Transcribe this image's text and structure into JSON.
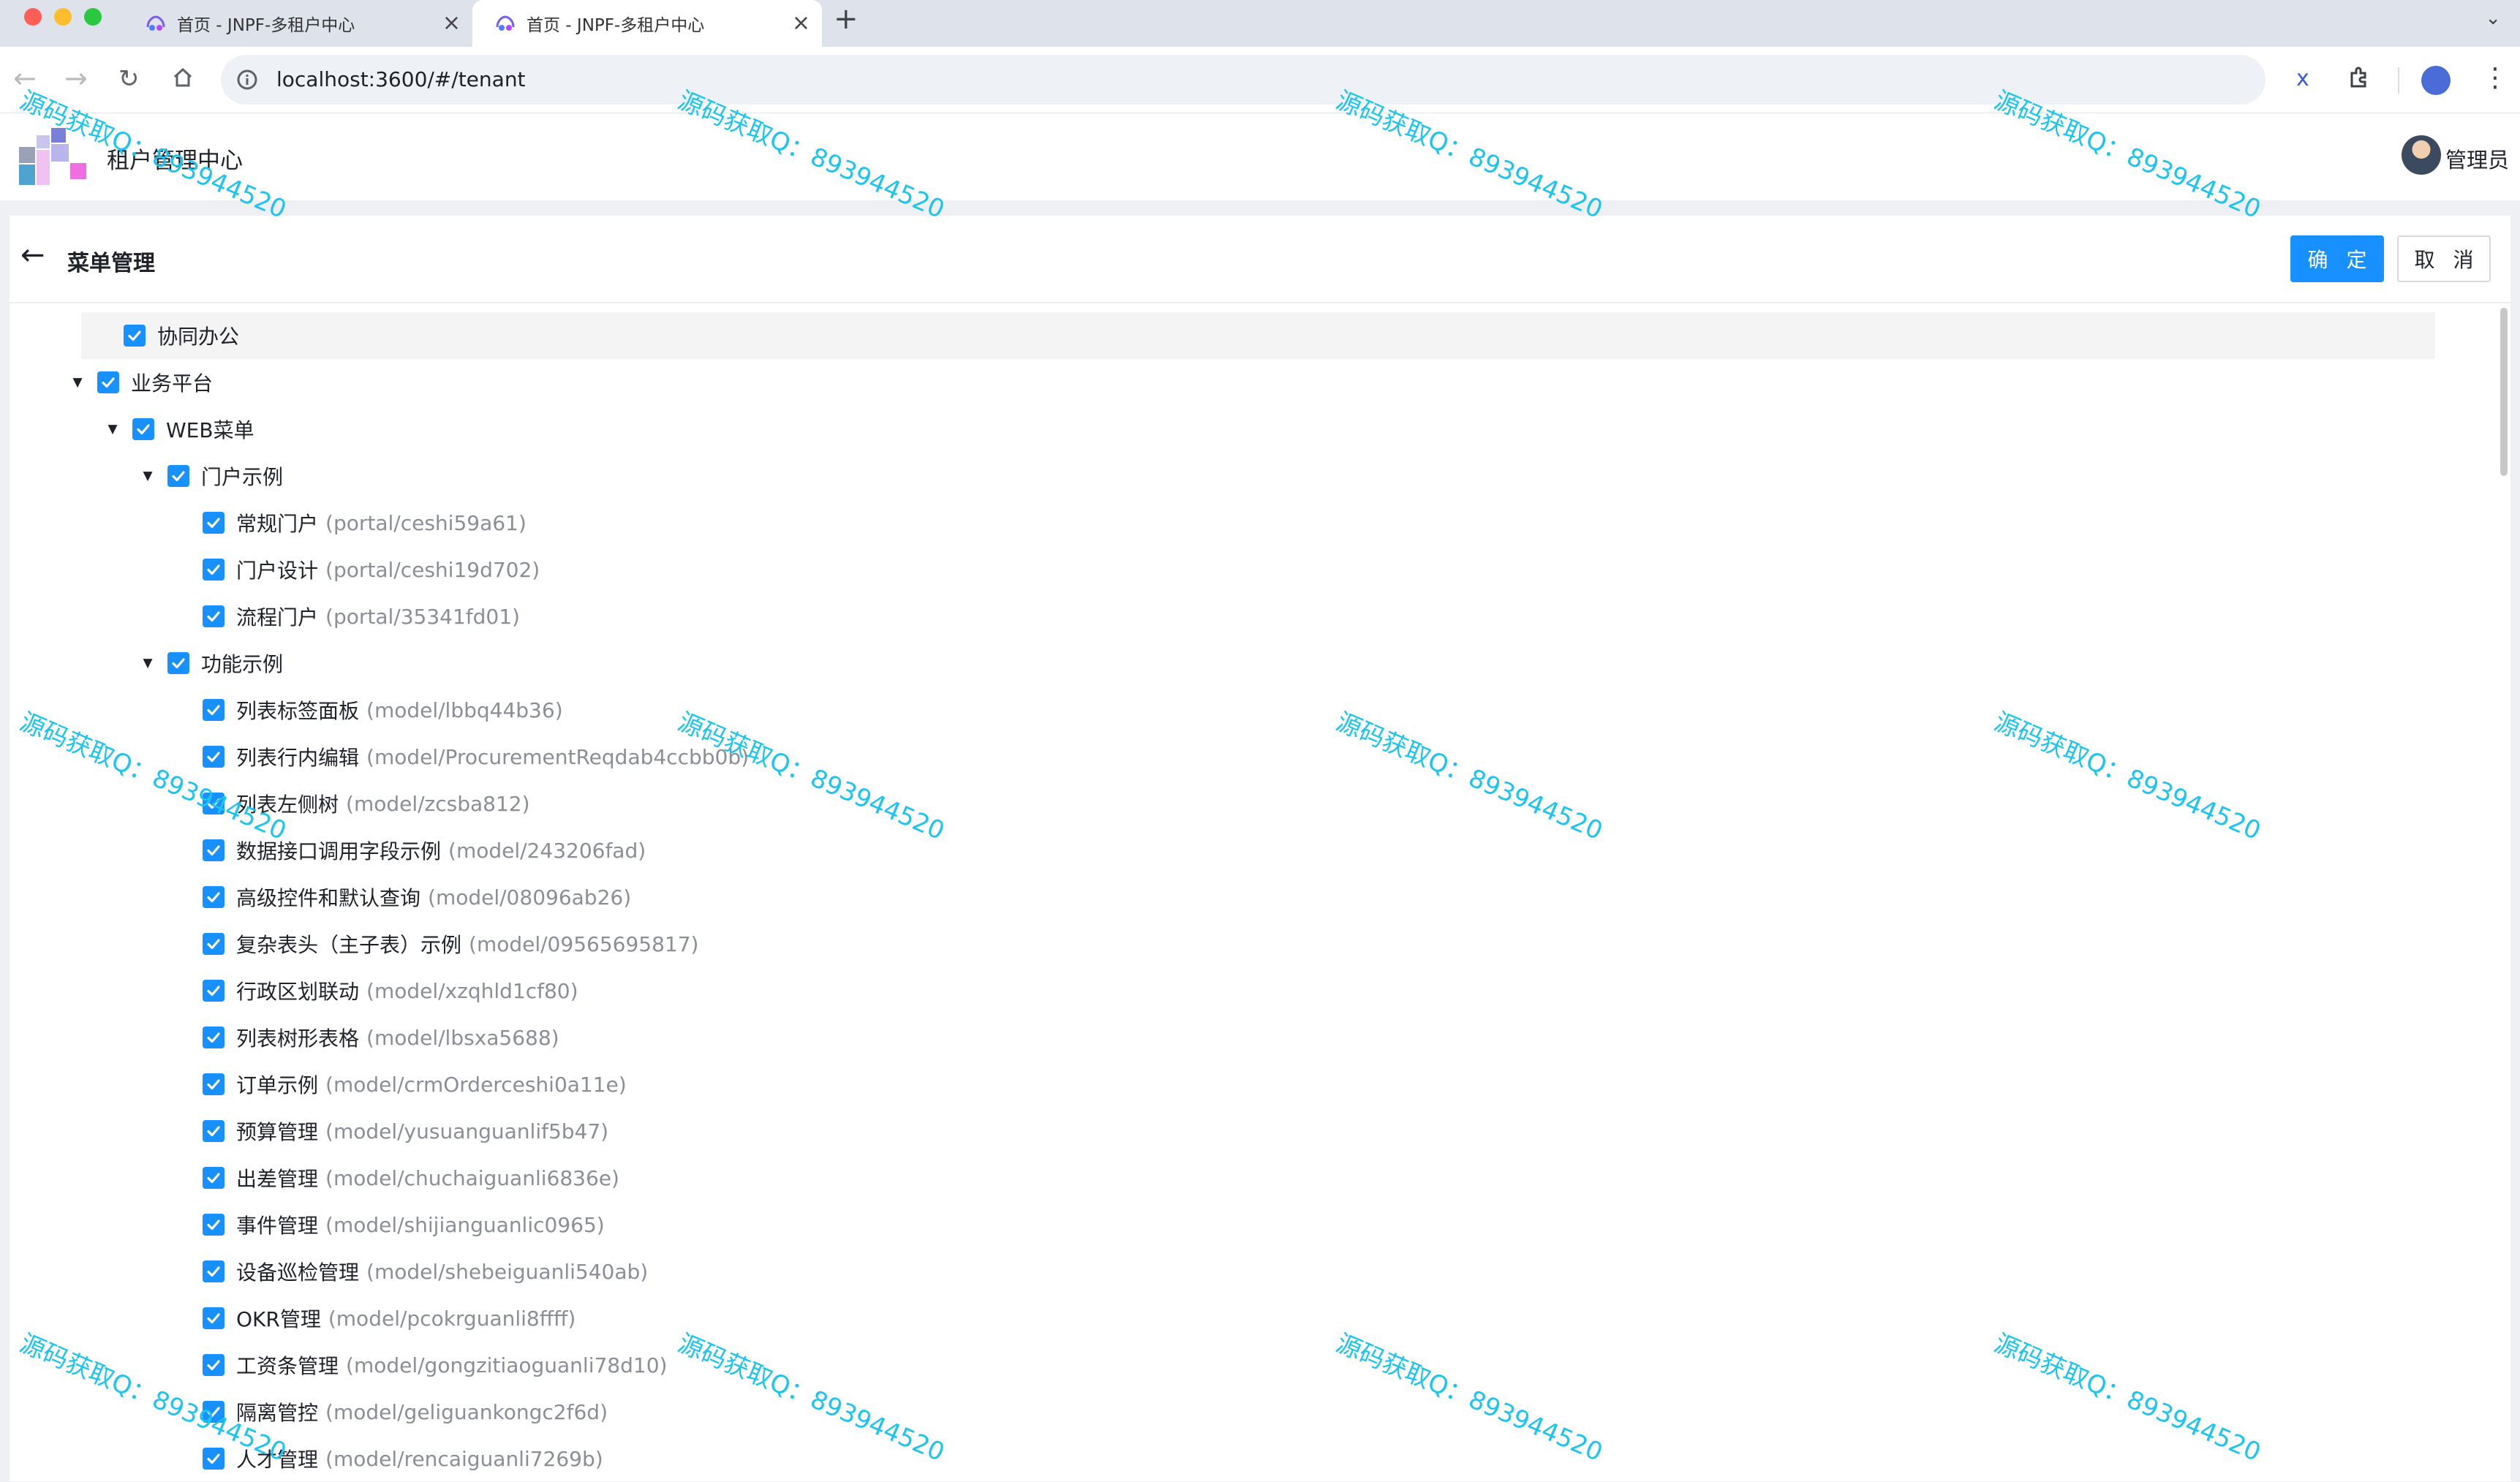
{
  "browser": {
    "tabs": [
      {
        "title": "首页 - JNPF-多租户中心",
        "active": false
      },
      {
        "title": "首页 - JNPF-多租户中心",
        "active": true
      }
    ],
    "new_tab": "+",
    "url": "localhost:3600/#/tenant"
  },
  "header": {
    "app_title": "租户管理中心",
    "user_name": "管理员"
  },
  "page": {
    "title": "菜单管理",
    "confirm_label": "确 定",
    "cancel_label": "取 消"
  },
  "tree": {
    "items": [
      {
        "label": "协同办公",
        "code": "",
        "level": 0,
        "expanded": null,
        "checked": true
      },
      {
        "label": "业务平台",
        "code": "",
        "level": 0,
        "expanded": true,
        "checked": true
      },
      {
        "label": "WEB菜单",
        "code": "",
        "level": 1,
        "expanded": true,
        "checked": true
      },
      {
        "label": "门户示例",
        "code": "",
        "level": 2,
        "expanded": true,
        "checked": true
      },
      {
        "label": "常规门户",
        "code": "(portal/ceshi59a61)",
        "level": 3,
        "expanded": null,
        "checked": true
      },
      {
        "label": "门户设计",
        "code": "(portal/ceshi19d702)",
        "level": 3,
        "expanded": null,
        "checked": true
      },
      {
        "label": "流程门户",
        "code": "(portal/35341fd01)",
        "level": 3,
        "expanded": null,
        "checked": true
      },
      {
        "label": "功能示例",
        "code": "",
        "level": 2,
        "expanded": true,
        "checked": true
      },
      {
        "label": "列表标签面板",
        "code": "(model/lbbq44b36)",
        "level": 3,
        "expanded": null,
        "checked": true
      },
      {
        "label": "列表行内编辑",
        "code": "(model/ProcurementReqdab4ccbb0b)",
        "level": 3,
        "expanded": null,
        "checked": true
      },
      {
        "label": "列表左侧树",
        "code": "(model/zcsba812)",
        "level": 3,
        "expanded": null,
        "checked": true
      },
      {
        "label": "数据接口调用字段示例",
        "code": "(model/243206fad)",
        "level": 3,
        "expanded": null,
        "checked": true
      },
      {
        "label": "高级控件和默认查询",
        "code": "(model/08096ab26)",
        "level": 3,
        "expanded": null,
        "checked": true
      },
      {
        "label": "复杂表头（主子表）示例",
        "code": "(model/09565695817)",
        "level": 3,
        "expanded": null,
        "checked": true
      },
      {
        "label": "行政区划联动",
        "code": "(model/xzqhld1cf80)",
        "level": 3,
        "expanded": null,
        "checked": true
      },
      {
        "label": "列表树形表格",
        "code": "(model/lbsxa5688)",
        "level": 3,
        "expanded": null,
        "checked": true
      },
      {
        "label": "订单示例",
        "code": "(model/crmOrderceshi0a11e)",
        "level": 3,
        "expanded": null,
        "checked": true
      },
      {
        "label": "预算管理",
        "code": "(model/yusuanguanlif5b47)",
        "level": 3,
        "expanded": null,
        "checked": true
      },
      {
        "label": "出差管理",
        "code": "(model/chuchaiguanli6836e)",
        "level": 3,
        "expanded": null,
        "checked": true
      },
      {
        "label": "事件管理",
        "code": "(model/shijianguanlic0965)",
        "level": 3,
        "expanded": null,
        "checked": true
      },
      {
        "label": "设备巡检管理",
        "code": "(model/shebeiguanli540ab)",
        "level": 3,
        "expanded": null,
        "checked": true
      },
      {
        "label": "OKR管理",
        "code": "(model/pcokrguanli8ffff)",
        "level": 3,
        "expanded": null,
        "checked": true
      },
      {
        "label": "工资条管理",
        "code": "(model/gongzitiaoguanli78d10)",
        "level": 3,
        "expanded": null,
        "checked": true
      },
      {
        "label": "隔离管控",
        "code": "(model/geliguankongc2f6d)",
        "level": 3,
        "expanded": null,
        "checked": true
      },
      {
        "label": "人才管理",
        "code": "(model/rencaiguanli7269b)",
        "level": 3,
        "expanded": null,
        "checked": true
      }
    ]
  },
  "watermark": {
    "text": "源码获取Q：893944520"
  },
  "colors": {
    "primary": "#1890ff",
    "watermark": "#1cc4f2"
  }
}
